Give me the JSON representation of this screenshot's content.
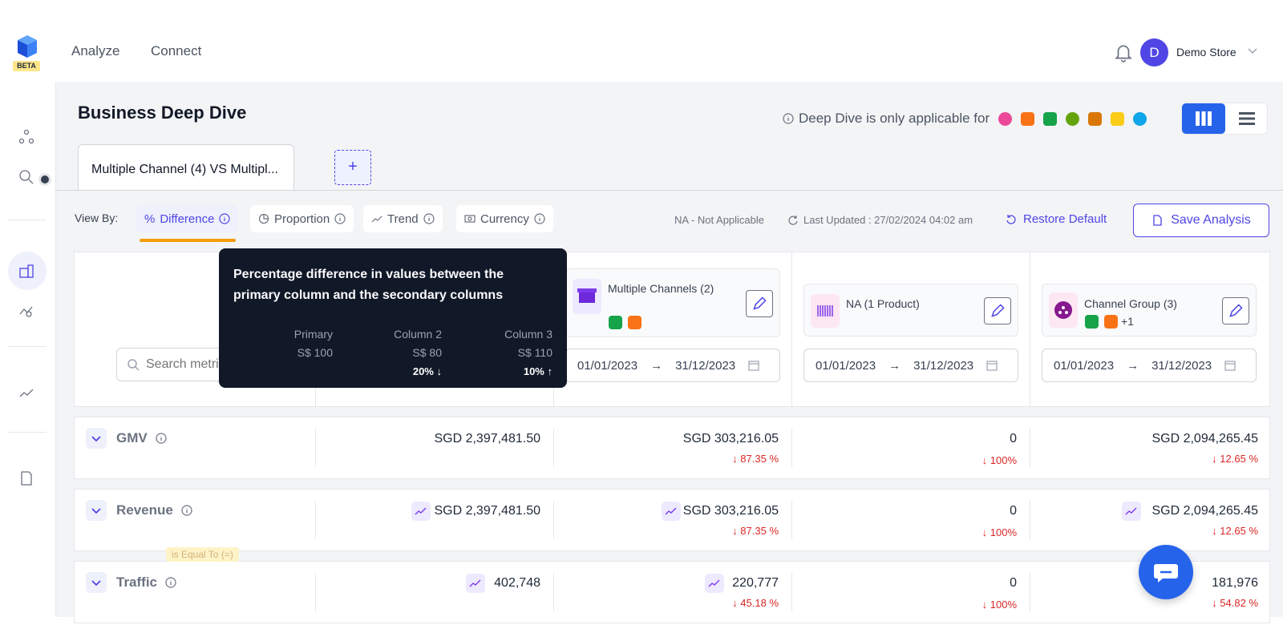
{
  "app": {
    "beta_badge": "BETA"
  },
  "nav": {
    "analyze": "Analyze",
    "connect": "Connect"
  },
  "user": {
    "avatar_letter": "D",
    "store_name": "Demo Store"
  },
  "page": {
    "title": "Business Deep Dive",
    "deep_dive_note": "Deep Dive is only applicable for",
    "tab_label": "Multiple Channel (4) VS Multipl...",
    "add_tab": "+"
  },
  "toolbar": {
    "view_by_label": "View By:",
    "view_options": [
      {
        "label": "Difference",
        "prefix": "%",
        "active": true
      },
      {
        "label": "Proportion"
      },
      {
        "label": "Trend"
      },
      {
        "label": "Currency"
      }
    ],
    "na_note": "NA - Not Applicable",
    "last_updated": "Last Updated : 27/02/2024 04:02 am",
    "restore": "Restore Default",
    "save": "Save Analysis"
  },
  "search": {
    "placeholder": "Search metri"
  },
  "columns": [
    {
      "name": "Multiple Channels (2)",
      "date_from": "01/01/2023",
      "date_to": "31/12/2023"
    },
    {
      "name": "NA (1 Product)",
      "date_from": "01/01/2023",
      "date_to": "31/12/2023"
    },
    {
      "name": "Channel Group (3)",
      "extra": "+1",
      "date_from": "01/01/2023",
      "date_to": "31/12/2023"
    }
  ],
  "date_arrow": "→",
  "rows": [
    {
      "name": "GMV",
      "primary": "SGD 2,397,481.50",
      "c1": "SGD 303,216.05",
      "c1_pct": "87.35 %",
      "c2": "0",
      "c2_pct": "100%",
      "c3": "SGD 2,094,265.45",
      "c3_pct": "12.65 %"
    },
    {
      "name": "Revenue",
      "primary": "SGD 2,397,481.50",
      "c1": "SGD 303,216.05",
      "c1_pct": "87.35 %",
      "c2": "0",
      "c2_pct": "100%",
      "c3": "SGD 2,094,265.45",
      "c3_pct": "12.65 %"
    },
    {
      "name": "Traffic",
      "primary": "402,748",
      "c1": "220,777",
      "c1_pct": "45.18 %",
      "c2": "0",
      "c2_pct": "100%",
      "c3": "181,976",
      "c3_pct": "54.82 %"
    }
  ],
  "equal_tag": "is Equal To (=)",
  "tooltip": {
    "text": "Percentage difference in values between the primary column and the secondary columns",
    "primary_label": "Primary",
    "primary_value": "S$ 100",
    "col2_label": "Column 2",
    "col2_value": "S$ 80",
    "col2_pct": "20%",
    "col3_label": "Column 3",
    "col3_value": "S$ 110",
    "col3_pct": "10%"
  },
  "colors": {
    "accent": "#4f46e5",
    "primary_button": "#2563eb",
    "negative": "#dc2626",
    "highlight": "#f59e0b"
  }
}
